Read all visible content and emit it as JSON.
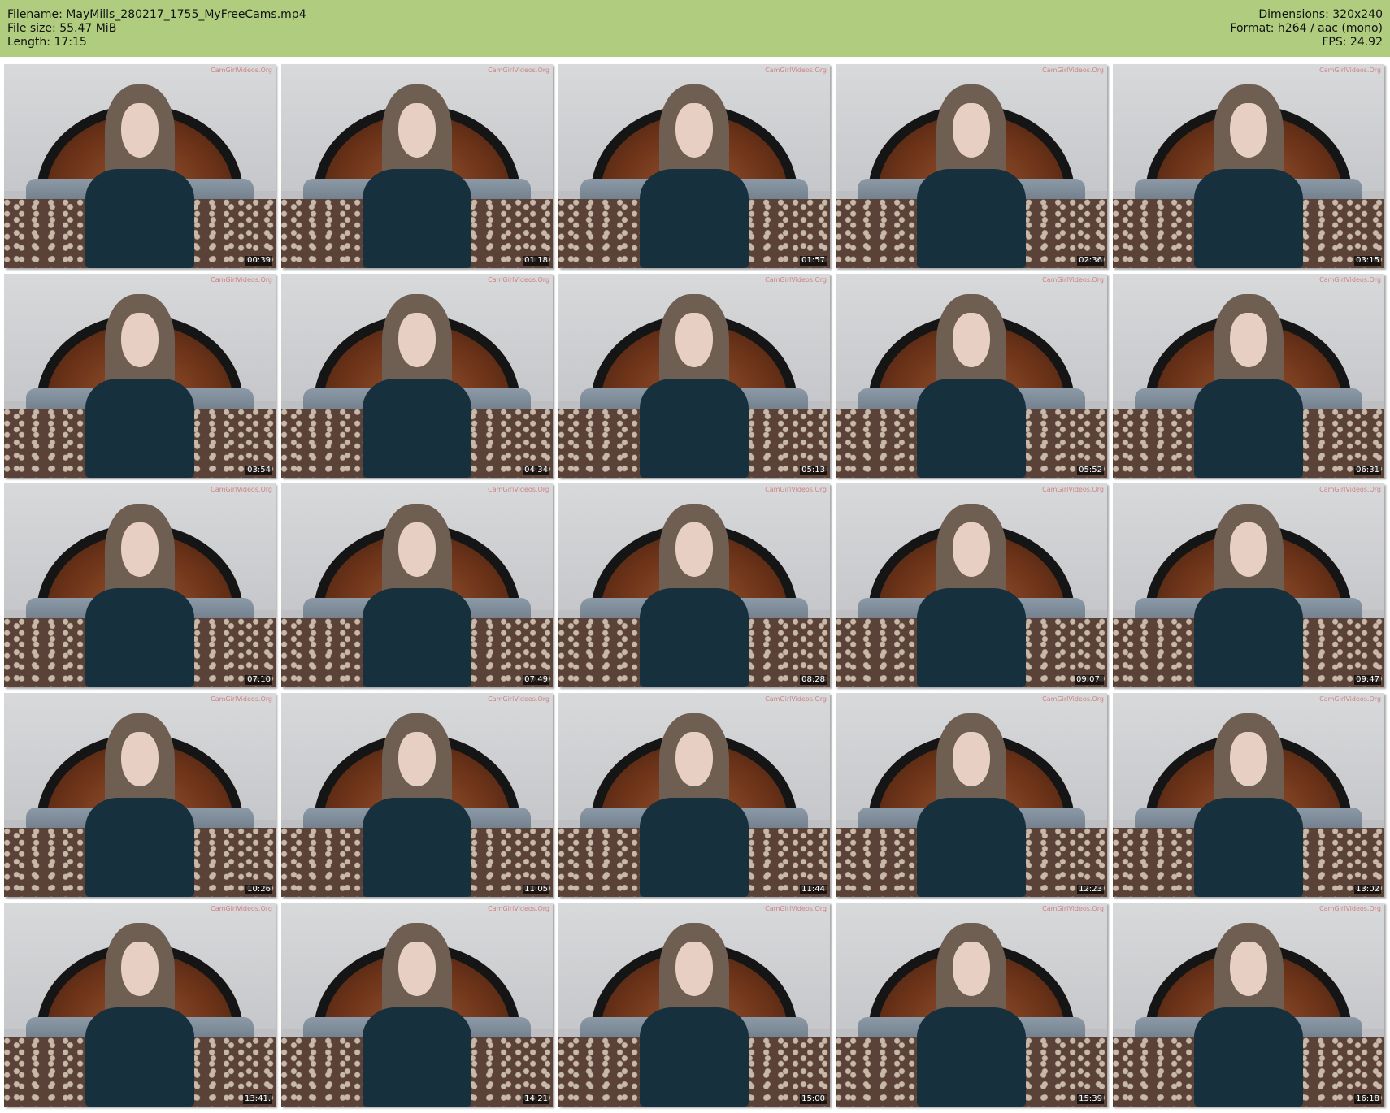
{
  "header": {
    "left": [
      "Filename: MayMills_280217_1755_MyFreeCams.mp4",
      "File size: 55.47 MiB",
      "Length: 17:15"
    ],
    "right": [
      "Dimensions: 320x240",
      "Format: h264 / aac (mono)",
      "FPS: 24.92"
    ]
  },
  "watermark": "CamGirlVideos.Org",
  "colors": {
    "header_bg": "#b0cc7e",
    "shirt": "#17303e",
    "headboard": "#6a3218"
  },
  "thumbnails": [
    "00:39",
    "01:18",
    "01:57",
    "02:36",
    "03:15",
    "03:54",
    "04:34",
    "05:13",
    "05:52",
    "06:31",
    "07:10",
    "07:49",
    "08:28",
    "09:07.",
    "09:47",
    "10:26",
    "11:05",
    "11:44",
    "12:23",
    "13:02",
    "13:41.",
    "14:21",
    "15:00",
    "15:39",
    "16:18"
  ]
}
